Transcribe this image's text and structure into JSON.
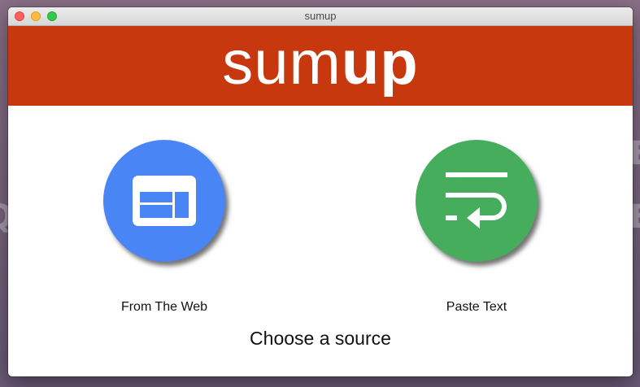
{
  "window": {
    "title": "sumup"
  },
  "banner": {
    "logo_light": "sum",
    "logo_bold": "up",
    "color": "#c8380f"
  },
  "sources": [
    {
      "label": "From The Web",
      "icon": "browser-window-icon",
      "color": "#4a85f5"
    },
    {
      "label": "Paste Text",
      "icon": "text-wrap-icon",
      "color": "#45ad5b"
    }
  ],
  "prompt": "Choose a source"
}
